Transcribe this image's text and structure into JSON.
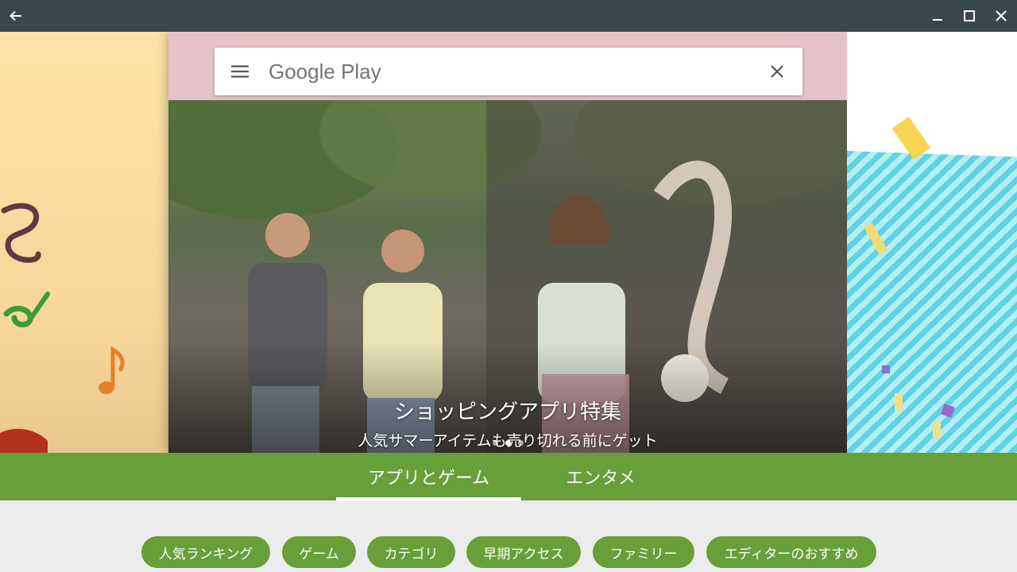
{
  "window": {
    "back_icon": "arrow-left-icon",
    "minimize_icon": "minimize-icon",
    "maximize_icon": "maximize-icon",
    "close_icon": "close-icon"
  },
  "search": {
    "menu_icon": "hamburger-menu-icon",
    "placeholder": "Google Play",
    "clear_icon": "close-icon"
  },
  "banner": {
    "title": "ショッピングアプリ特集",
    "subtitle": "人気サマーアイテムも売り切れる前にゲット",
    "page_count": 3,
    "active_page": 1
  },
  "tabs": [
    {
      "label": "アプリとゲーム",
      "selected": true
    },
    {
      "label": "エンタメ",
      "selected": false
    }
  ],
  "chips": [
    "人気ランキング",
    "ゲーム",
    "カテゴリ",
    "早期アクセス",
    "ファミリー",
    "エディターのおすすめ"
  ],
  "colors": {
    "titlebar": "#37474f",
    "accent_green": "#689f38",
    "background": "#ececec"
  }
}
